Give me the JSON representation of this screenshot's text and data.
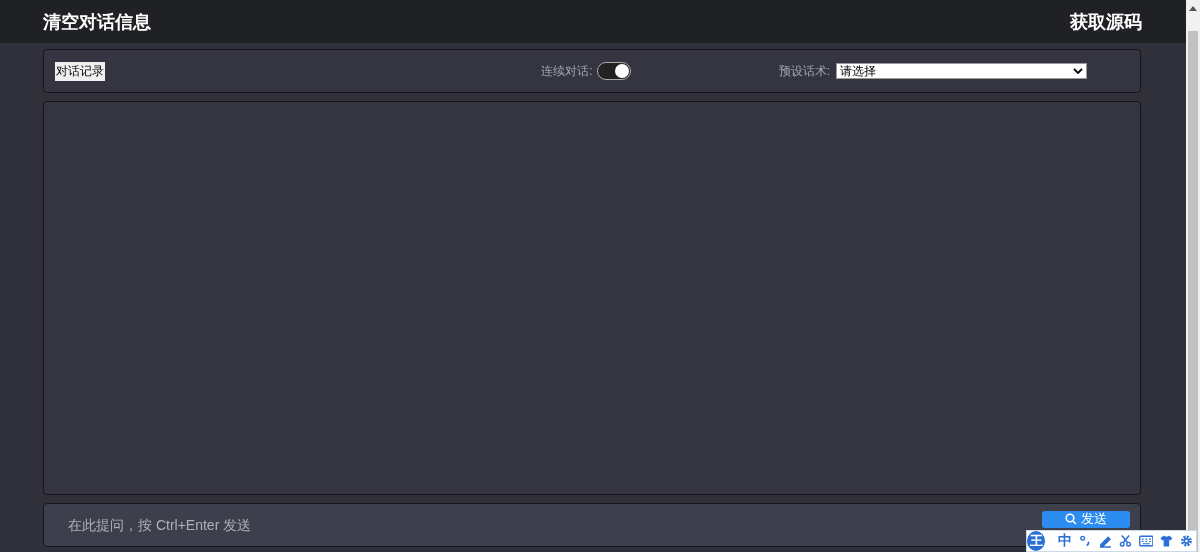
{
  "header": {
    "left_link": "清空对话信息",
    "right_link": "获取源码"
  },
  "toolbar": {
    "history_button": "对话记录",
    "continuous": {
      "label": "连续对话:",
      "on": true
    },
    "preset": {
      "label": "预设话术:",
      "value": "请选择"
    }
  },
  "input": {
    "placeholder": "在此提问，按 Ctrl+Enter 发送",
    "send_button": "发送"
  },
  "ime_bar": {
    "logo": "王",
    "mode": "中"
  }
}
